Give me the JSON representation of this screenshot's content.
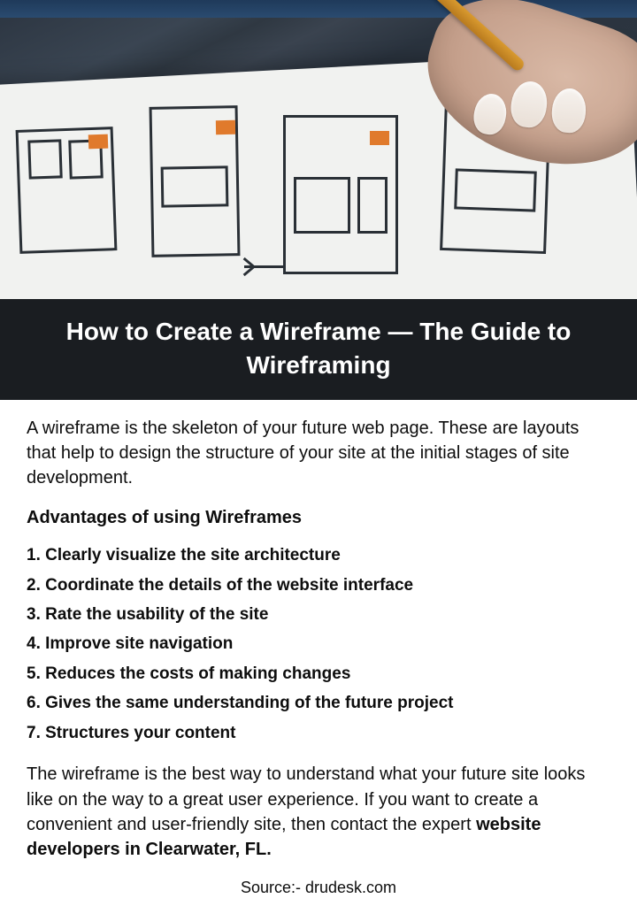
{
  "title": "How to Create a Wireframe — The Guide to Wireframing",
  "intro": "A wireframe is the skeleton of your future web page. These are layouts that help to design the structure of your site at the initial stages of site development.",
  "subhead": "Advantages of using Wireframes",
  "advantages": [
    "1. Clearly visualize the site architecture",
    "2. Coordinate the details of the website interface",
    "3. Rate the usability of the site",
    "4. Improve site navigation",
    "5. Reduces the costs of making changes",
    "6. Gives the same understanding of the future project",
    "7. Structures your content"
  ],
  "closing_plain": "The wireframe is the best way to understand what your future site looks like on the way to a great user experience. If you want to create a convenient and user-friendly site, then contact the expert ",
  "closing_bold": "website developers in Clearwater, FL.",
  "source": "Source:-  drudesk.com"
}
